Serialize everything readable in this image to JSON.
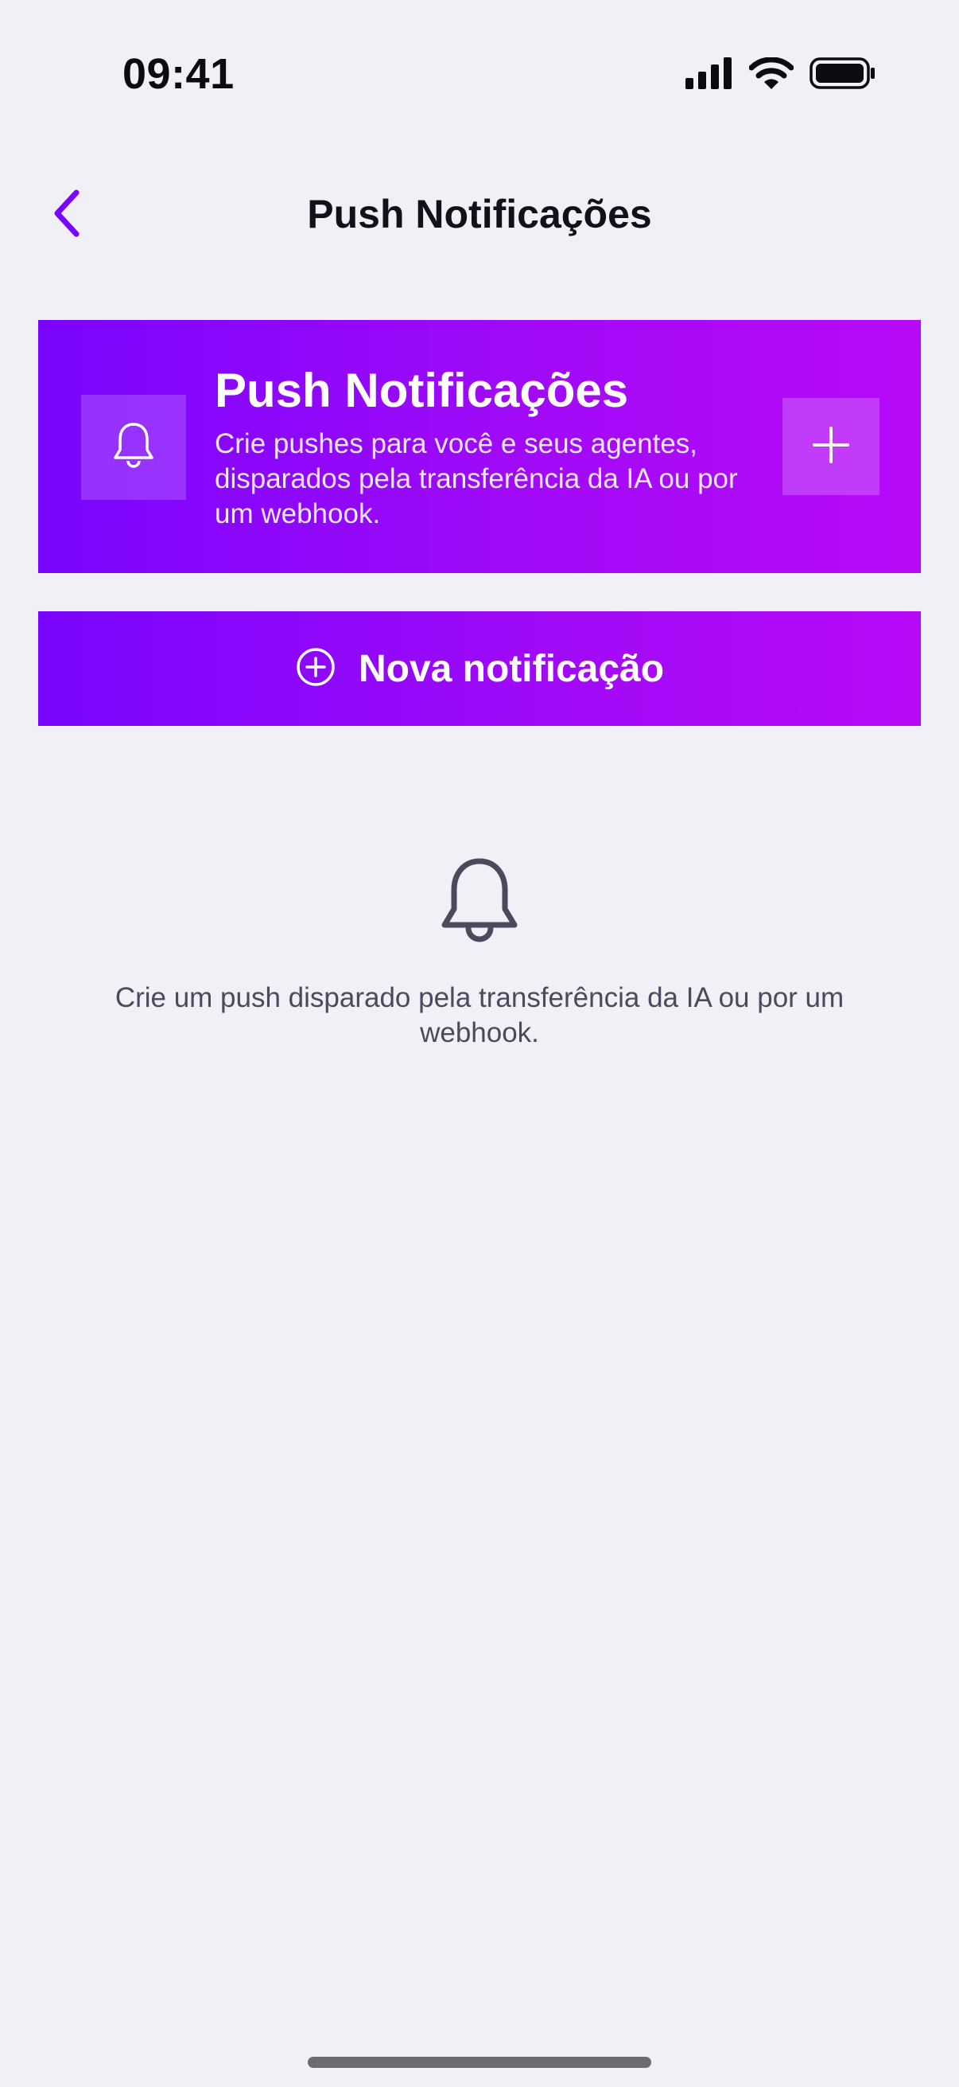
{
  "status_bar": {
    "time": "09:41",
    "icons": [
      "signal-icon",
      "wifi-icon",
      "battery-icon"
    ]
  },
  "header": {
    "title": "Push Notificações",
    "back_icon": "chevron-left-icon"
  },
  "hero": {
    "title": "Push Notificações",
    "description": "Crie pushes para você e seus agentes, disparados pela transferência da IA ou por um webhook.",
    "bell_icon": "bell-icon",
    "add_icon": "plus-icon"
  },
  "actions": {
    "new_notification_label": "Nova notificação",
    "new_notification_icon": "plus-circle-icon"
  },
  "empty_state": {
    "icon": "bell-icon",
    "message": "Crie um push disparado pela transferência da IA ou por um webhook."
  },
  "colors": {
    "accent": "#7A05FF",
    "accent_end": "#B70AF9",
    "background": "#F1F0F7",
    "text_primary": "#11111A",
    "text_secondary": "#4A4A5C"
  }
}
